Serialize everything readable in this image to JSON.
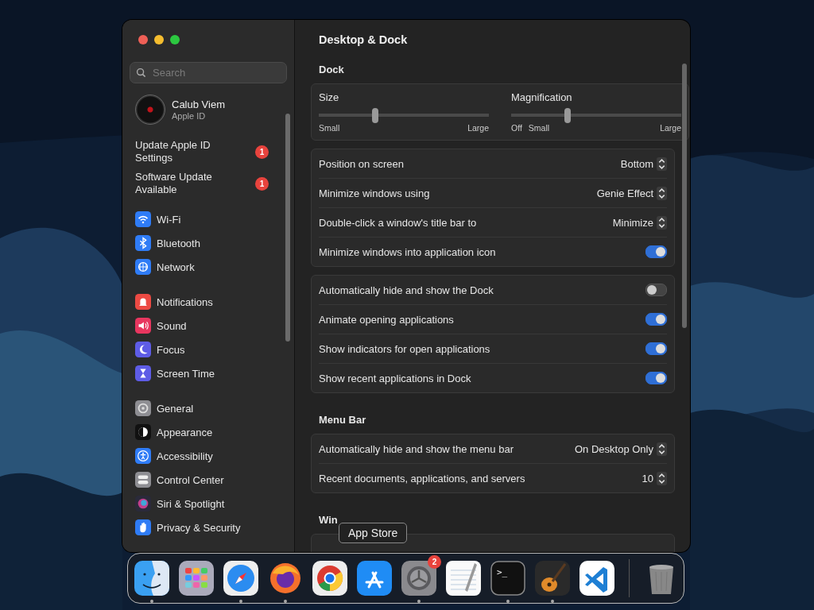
{
  "window": {
    "title": "Desktop & Dock"
  },
  "sidebar": {
    "search": {
      "placeholder": "Search"
    },
    "account": {
      "name": "Calub Viem",
      "subtitle": "Apple ID"
    },
    "alerts": [
      {
        "label": "Update Apple ID Settings",
        "badge": "1"
      },
      {
        "label": "Software Update Available",
        "badge": "1"
      }
    ],
    "groups": [
      [
        {
          "kind": "wifi",
          "label": "Wi-Fi"
        },
        {
          "kind": "bluetooth",
          "label": "Bluetooth"
        },
        {
          "kind": "network",
          "label": "Network"
        }
      ],
      [
        {
          "kind": "notifications",
          "label": "Notifications"
        },
        {
          "kind": "sound",
          "label": "Sound"
        },
        {
          "kind": "focus",
          "label": "Focus"
        },
        {
          "kind": "screentime",
          "label": "Screen Time"
        }
      ],
      [
        {
          "kind": "general",
          "label": "General"
        },
        {
          "kind": "appearance",
          "label": "Appearance"
        },
        {
          "kind": "accessibility",
          "label": "Accessibility"
        },
        {
          "kind": "controlcenter",
          "label": "Control Center"
        },
        {
          "kind": "siri",
          "label": "Siri & Spotlight"
        },
        {
          "kind": "privacy",
          "label": "Privacy & Security"
        }
      ]
    ]
  },
  "sections": [
    {
      "heading": "Dock",
      "cards": [
        {
          "kind": "sliders",
          "sliders": [
            {
              "label": "Size",
              "level": 0.33,
              "marks": [
                "Small",
                "Large"
              ]
            },
            {
              "label": "Magnification",
              "level": 0.33,
              "marks": [
                "Off",
                "Small",
                "Large"
              ]
            }
          ]
        },
        {
          "kind": "rows",
          "rows": [
            {
              "kind": "popup",
              "label": "Position on screen",
              "value": "Bottom"
            },
            {
              "kind": "popup",
              "label": "Minimize windows using",
              "value": "Genie Effect"
            },
            {
              "kind": "popup",
              "label": "Double-click a window's title bar to",
              "value": "Minimize"
            },
            {
              "kind": "switch",
              "label": "Minimize windows into application icon",
              "on": true
            }
          ]
        },
        {
          "kind": "rows",
          "rows": [
            {
              "kind": "switch",
              "label": "Automatically hide and show the Dock",
              "on": false
            },
            {
              "kind": "switch",
              "label": "Animate opening applications",
              "on": true
            },
            {
              "kind": "switch",
              "label": "Show indicators for open applications",
              "on": true
            },
            {
              "kind": "switch",
              "label": "Show recent applications in Dock",
              "on": true
            }
          ]
        }
      ]
    },
    {
      "heading": "Menu Bar",
      "cards": [
        {
          "kind": "rows",
          "rows": [
            {
              "kind": "popup",
              "label": "Automatically hide and show the menu bar",
              "value": "On Desktop Only"
            },
            {
              "kind": "popup",
              "label": "Recent documents, applications, and servers",
              "value": "10"
            }
          ]
        }
      ]
    },
    {
      "heading": "Win",
      "cards": [
        {
          "kind": "rows"
        }
      ]
    }
  ],
  "tooltip": {
    "label": "App Store"
  },
  "dock": {
    "apps": [
      {
        "kind": "finder",
        "running": true
      },
      {
        "kind": "launchpad",
        "running": false
      },
      {
        "kind": "safari",
        "running": true
      },
      {
        "kind": "firefox",
        "running": true
      },
      {
        "kind": "chrome",
        "running": false
      },
      {
        "kind": "appstore",
        "running": false
      },
      {
        "kind": "settings",
        "running": true,
        "badge": "2"
      },
      {
        "kind": "textedit",
        "running": false
      },
      {
        "kind": "terminal",
        "running": true,
        "prompt": ">_"
      },
      {
        "kind": "garageband",
        "running": true
      },
      {
        "kind": "vscode",
        "running": false
      }
    ],
    "trash": {
      "kind": "trash"
    }
  }
}
